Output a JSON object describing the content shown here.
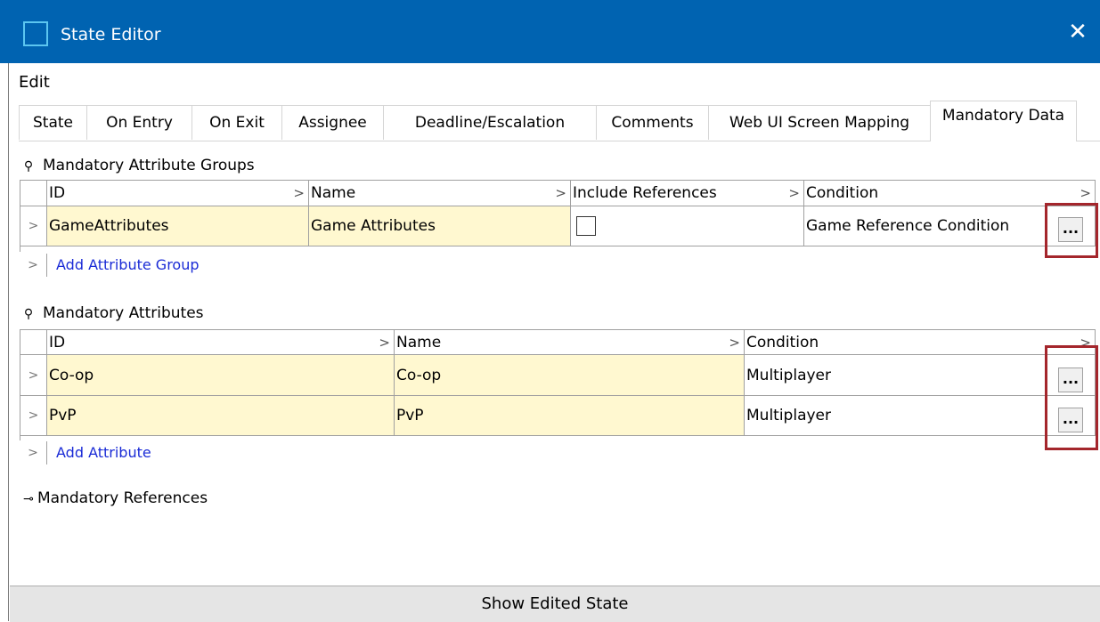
{
  "window": {
    "title": "State Editor",
    "close_glyph": "✕"
  },
  "menu": {
    "items": [
      "Edit"
    ]
  },
  "tabs": [
    {
      "label": "State"
    },
    {
      "label": "On Entry"
    },
    {
      "label": "On Exit"
    },
    {
      "label": "Assignee"
    },
    {
      "label": "Deadline/Escalation"
    },
    {
      "label": "Comments"
    },
    {
      "label": "Web UI Screen Mapping"
    },
    {
      "label": "Mandatory Data",
      "active": true
    }
  ],
  "groups_section": {
    "title": "Mandatory Attribute Groups",
    "columns": [
      "ID",
      "Name",
      "Include References",
      "Condition"
    ],
    "rows": [
      {
        "id": "GameAttributes",
        "name": "Game Attributes",
        "include_references": false,
        "condition": "Game Reference Condition"
      }
    ],
    "add_label": "Add Attribute Group"
  },
  "attributes_section": {
    "title": "Mandatory Attributes",
    "columns": [
      "ID",
      "Name",
      "Condition"
    ],
    "rows": [
      {
        "id": "Co-op",
        "name": "Co-op",
        "condition": "Multiplayer"
      },
      {
        "id": "PvP",
        "name": "PvP",
        "condition": "Multiplayer"
      }
    ],
    "add_label": "Add Attribute"
  },
  "references_section": {
    "title": "Mandatory References"
  },
  "buttons": {
    "ellipsis": "...",
    "show_edited_state": "Show Edited State"
  },
  "glyphs": {
    "row_arrow": ">",
    "header_arrow": ">"
  },
  "colors": {
    "titlebar": "#0063b1",
    "row_highlight": "#fff8d0",
    "link": "#1a2bd6",
    "callout": "#a4262c"
  }
}
